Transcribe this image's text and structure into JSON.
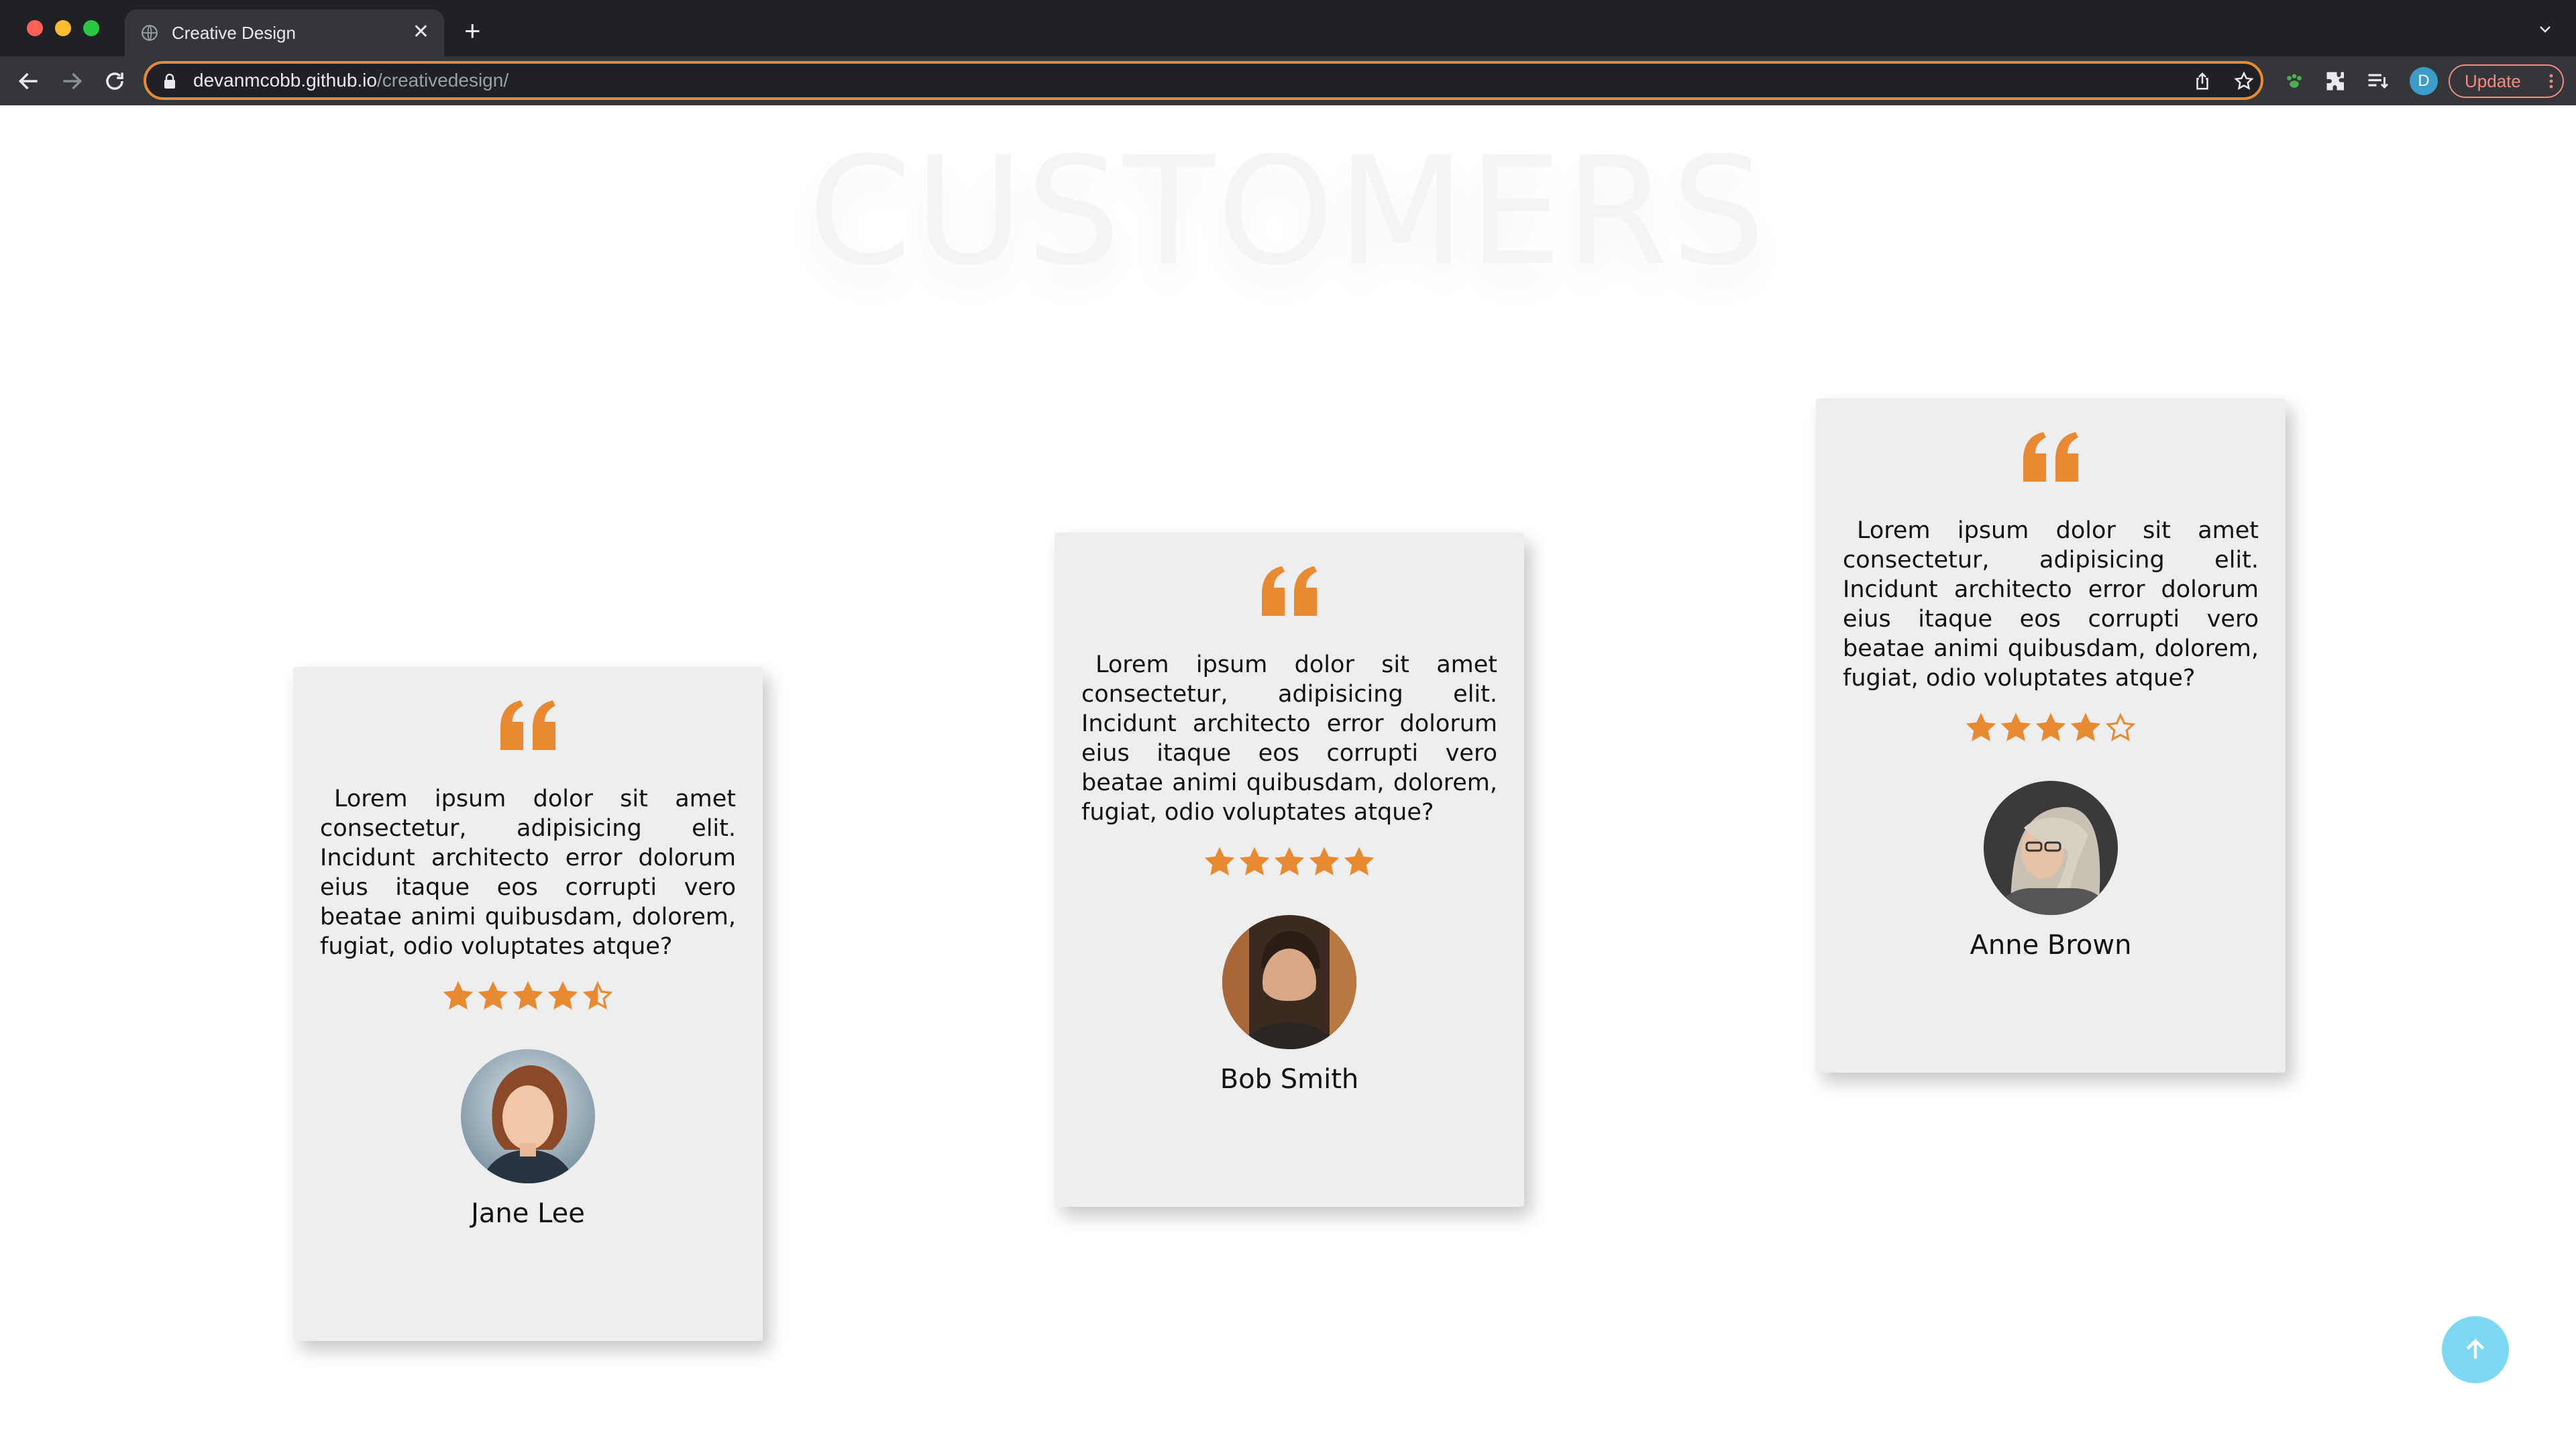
{
  "browser": {
    "tab_title": "Creative Design",
    "url_host": "devanmcobb.github.io",
    "url_path": "/creativedesign/",
    "profile_initial": "D",
    "update_label": "Update"
  },
  "page": {
    "section_title": "CUSTOMERS",
    "testimonials": [
      {
        "text": "Lorem ipsum dolor sit amet consectetur, adipisicing elit. Incidunt architecto error dolorum eius itaque eos corrupti vero beatae animi quibusdam, dolorem, fugiat, odio voluptates atque?",
        "rating": 4.5,
        "name": "Jane Lee"
      },
      {
        "text": "Lorem ipsum dolor sit amet consectetur, adipisicing elit. Incidunt architecto error dolorum eius itaque eos corrupti vero beatae animi quibusdam, dolorem, fugiat, odio voluptates atque?",
        "rating": 5,
        "name": "Bob Smith"
      },
      {
        "text": "Lorem ipsum dolor sit amet consectetur, adipisicing elit. Incidunt architecto error dolorum eius itaque eos corrupti vero beatae animi quibusdam, dolorem, fugiat, odio voluptates atque?",
        "rating": 4,
        "name": "Anne Brown"
      }
    ]
  },
  "colors": {
    "accent": "#e88a32",
    "card_bg": "#eeeeee",
    "scroll_button": "#7fd8f3"
  }
}
